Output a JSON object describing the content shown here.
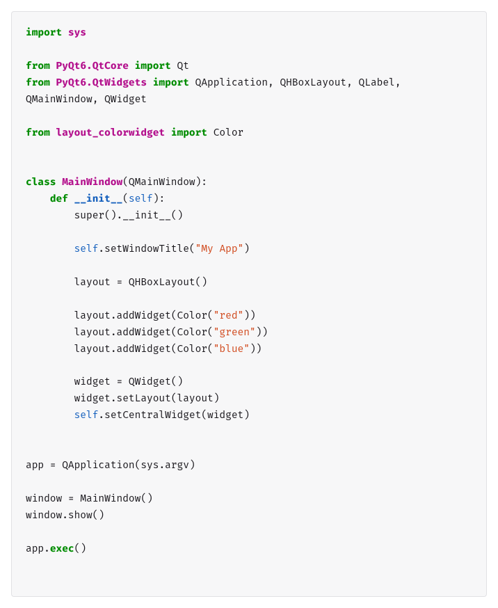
{
  "code": {
    "tokens": [
      {
        "cls": "tok-keyword",
        "t": "import"
      },
      {
        "cls": "tok-punct",
        "t": " "
      },
      {
        "cls": "tok-module",
        "t": "sys"
      },
      {
        "cls": "",
        "t": "\n\n"
      },
      {
        "cls": "tok-keyword",
        "t": "from"
      },
      {
        "cls": "tok-punct",
        "t": " "
      },
      {
        "cls": "tok-module",
        "t": "PyQt6.QtCore"
      },
      {
        "cls": "tok-punct",
        "t": " "
      },
      {
        "cls": "tok-keyword",
        "t": "import"
      },
      {
        "cls": "tok-punct",
        "t": " "
      },
      {
        "cls": "tok-name",
        "t": "Qt"
      },
      {
        "cls": "",
        "t": "\n"
      },
      {
        "cls": "tok-keyword",
        "t": "from"
      },
      {
        "cls": "tok-punct",
        "t": " "
      },
      {
        "cls": "tok-module",
        "t": "PyQt6.QtWidgets"
      },
      {
        "cls": "tok-punct",
        "t": " "
      },
      {
        "cls": "tok-keyword",
        "t": "import"
      },
      {
        "cls": "tok-punct",
        "t": " "
      },
      {
        "cls": "tok-name",
        "t": "QApplication"
      },
      {
        "cls": "tok-punct",
        "t": ", "
      },
      {
        "cls": "tok-name",
        "t": "QHBoxLayout"
      },
      {
        "cls": "tok-punct",
        "t": ", "
      },
      {
        "cls": "tok-name",
        "t": "QLabel"
      },
      {
        "cls": "tok-punct",
        "t": ", "
      },
      {
        "cls": "tok-name",
        "t": "QMainWindow"
      },
      {
        "cls": "tok-punct",
        "t": ", "
      },
      {
        "cls": "tok-name",
        "t": "QWidget"
      },
      {
        "cls": "",
        "t": "\n\n"
      },
      {
        "cls": "tok-keyword",
        "t": "from"
      },
      {
        "cls": "tok-punct",
        "t": " "
      },
      {
        "cls": "tok-module",
        "t": "layout_colorwidget"
      },
      {
        "cls": "tok-punct",
        "t": " "
      },
      {
        "cls": "tok-keyword",
        "t": "import"
      },
      {
        "cls": "tok-punct",
        "t": " "
      },
      {
        "cls": "tok-name",
        "t": "Color"
      },
      {
        "cls": "",
        "t": "\n\n\n"
      },
      {
        "cls": "tok-keyword",
        "t": "class"
      },
      {
        "cls": "tok-punct",
        "t": " "
      },
      {
        "cls": "tok-classname",
        "t": "MainWindow"
      },
      {
        "cls": "tok-punct",
        "t": "("
      },
      {
        "cls": "tok-name",
        "t": "QMainWindow"
      },
      {
        "cls": "tok-punct",
        "t": "):"
      },
      {
        "cls": "",
        "t": "\n    "
      },
      {
        "cls": "tok-keyword",
        "t": "def"
      },
      {
        "cls": "tok-punct",
        "t": " "
      },
      {
        "cls": "tok-defname",
        "t": "__init__"
      },
      {
        "cls": "tok-punct",
        "t": "("
      },
      {
        "cls": "tok-self",
        "t": "self"
      },
      {
        "cls": "tok-punct",
        "t": "):"
      },
      {
        "cls": "",
        "t": "\n        "
      },
      {
        "cls": "tok-name",
        "t": "super"
      },
      {
        "cls": "tok-punct",
        "t": "()."
      },
      {
        "cls": "tok-name",
        "t": "__init__"
      },
      {
        "cls": "tok-punct",
        "t": "()"
      },
      {
        "cls": "",
        "t": "\n\n        "
      },
      {
        "cls": "tok-self",
        "t": "self"
      },
      {
        "cls": "tok-punct",
        "t": "."
      },
      {
        "cls": "tok-name",
        "t": "setWindowTitle"
      },
      {
        "cls": "tok-punct",
        "t": "("
      },
      {
        "cls": "tok-string",
        "t": "\"My App\""
      },
      {
        "cls": "tok-punct",
        "t": ")"
      },
      {
        "cls": "",
        "t": "\n\n        "
      },
      {
        "cls": "tok-name",
        "t": "layout"
      },
      {
        "cls": "tok-punct",
        "t": " = "
      },
      {
        "cls": "tok-name",
        "t": "QHBoxLayout"
      },
      {
        "cls": "tok-punct",
        "t": "()"
      },
      {
        "cls": "",
        "t": "\n\n        "
      },
      {
        "cls": "tok-name",
        "t": "layout"
      },
      {
        "cls": "tok-punct",
        "t": "."
      },
      {
        "cls": "tok-name",
        "t": "addWidget"
      },
      {
        "cls": "tok-punct",
        "t": "("
      },
      {
        "cls": "tok-name",
        "t": "Color"
      },
      {
        "cls": "tok-punct",
        "t": "("
      },
      {
        "cls": "tok-string",
        "t": "\"red\""
      },
      {
        "cls": "tok-punct",
        "t": "))"
      },
      {
        "cls": "",
        "t": "\n        "
      },
      {
        "cls": "tok-name",
        "t": "layout"
      },
      {
        "cls": "tok-punct",
        "t": "."
      },
      {
        "cls": "tok-name",
        "t": "addWidget"
      },
      {
        "cls": "tok-punct",
        "t": "("
      },
      {
        "cls": "tok-name",
        "t": "Color"
      },
      {
        "cls": "tok-punct",
        "t": "("
      },
      {
        "cls": "tok-string",
        "t": "\"green\""
      },
      {
        "cls": "tok-punct",
        "t": "))"
      },
      {
        "cls": "",
        "t": "\n        "
      },
      {
        "cls": "tok-name",
        "t": "layout"
      },
      {
        "cls": "tok-punct",
        "t": "."
      },
      {
        "cls": "tok-name",
        "t": "addWidget"
      },
      {
        "cls": "tok-punct",
        "t": "("
      },
      {
        "cls": "tok-name",
        "t": "Color"
      },
      {
        "cls": "tok-punct",
        "t": "("
      },
      {
        "cls": "tok-string",
        "t": "\"blue\""
      },
      {
        "cls": "tok-punct",
        "t": "))"
      },
      {
        "cls": "",
        "t": "\n\n        "
      },
      {
        "cls": "tok-name",
        "t": "widget"
      },
      {
        "cls": "tok-punct",
        "t": " = "
      },
      {
        "cls": "tok-name",
        "t": "QWidget"
      },
      {
        "cls": "tok-punct",
        "t": "()"
      },
      {
        "cls": "",
        "t": "\n        "
      },
      {
        "cls": "tok-name",
        "t": "widget"
      },
      {
        "cls": "tok-punct",
        "t": "."
      },
      {
        "cls": "tok-name",
        "t": "setLayout"
      },
      {
        "cls": "tok-punct",
        "t": "("
      },
      {
        "cls": "tok-name",
        "t": "layout"
      },
      {
        "cls": "tok-punct",
        "t": ")"
      },
      {
        "cls": "",
        "t": "\n        "
      },
      {
        "cls": "tok-self",
        "t": "self"
      },
      {
        "cls": "tok-punct",
        "t": "."
      },
      {
        "cls": "tok-name",
        "t": "setCentralWidget"
      },
      {
        "cls": "tok-punct",
        "t": "("
      },
      {
        "cls": "tok-name",
        "t": "widget"
      },
      {
        "cls": "tok-punct",
        "t": ")"
      },
      {
        "cls": "",
        "t": "\n\n\n"
      },
      {
        "cls": "tok-name",
        "t": "app"
      },
      {
        "cls": "tok-punct",
        "t": " = "
      },
      {
        "cls": "tok-name",
        "t": "QApplication"
      },
      {
        "cls": "tok-punct",
        "t": "("
      },
      {
        "cls": "tok-name",
        "t": "sys"
      },
      {
        "cls": "tok-punct",
        "t": "."
      },
      {
        "cls": "tok-name",
        "t": "argv"
      },
      {
        "cls": "tok-punct",
        "t": ")"
      },
      {
        "cls": "",
        "t": "\n\n"
      },
      {
        "cls": "tok-name",
        "t": "window"
      },
      {
        "cls": "tok-punct",
        "t": " = "
      },
      {
        "cls": "tok-name",
        "t": "MainWindow"
      },
      {
        "cls": "tok-punct",
        "t": "()"
      },
      {
        "cls": "",
        "t": "\n"
      },
      {
        "cls": "tok-name",
        "t": "window"
      },
      {
        "cls": "tok-punct",
        "t": "."
      },
      {
        "cls": "tok-name",
        "t": "show"
      },
      {
        "cls": "tok-punct",
        "t": "()"
      },
      {
        "cls": "",
        "t": "\n\n"
      },
      {
        "cls": "tok-name",
        "t": "app"
      },
      {
        "cls": "tok-punct",
        "t": "."
      },
      {
        "cls": "tok-call",
        "t": "exec"
      },
      {
        "cls": "tok-punct",
        "t": "()"
      }
    ]
  }
}
